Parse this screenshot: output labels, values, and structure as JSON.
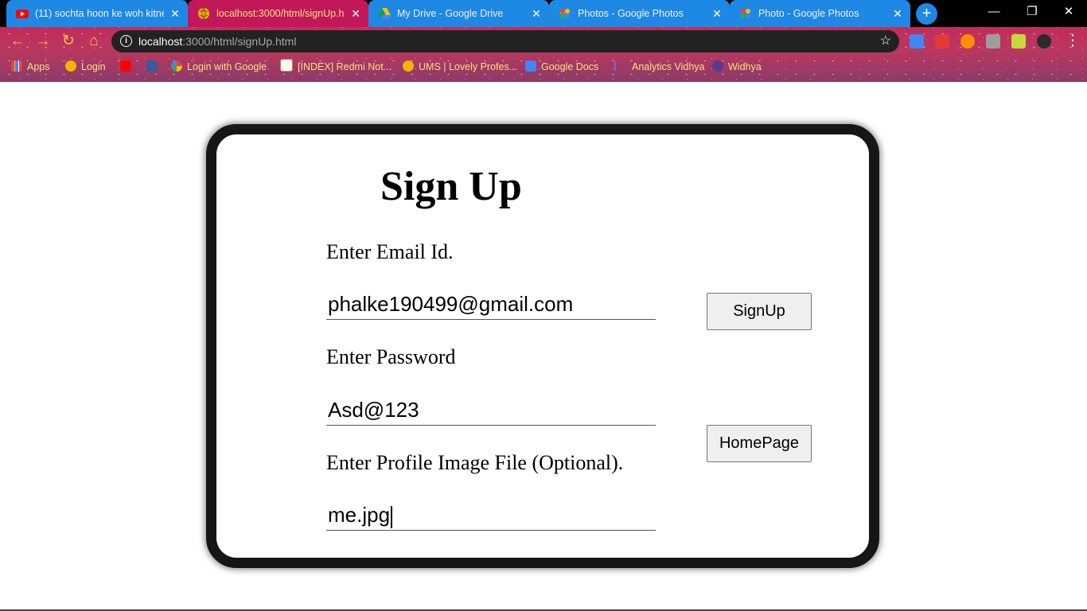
{
  "browser": {
    "tabs": [
      {
        "title": "(11) sochta hoon ke woh kitne",
        "icon": "youtube-icon"
      },
      {
        "title": "localhost:3000/html/signUp.ht",
        "icon": "globe-icon",
        "active": true
      },
      {
        "title": "My Drive - Google Drive",
        "icon": "google-drive-icon"
      },
      {
        "title": "Photos - Google Photos",
        "icon": "google-photos-icon"
      },
      {
        "title": "Photo - Google Photos",
        "icon": "google-photos-icon"
      }
    ],
    "new_tab": "+",
    "window_controls": {
      "minimize": "—",
      "restore": "❐",
      "close": "✕"
    },
    "address": {
      "host": "localhost",
      "path": ":3000/html/signUp.html"
    },
    "bookmarks": [
      {
        "label": "Apps",
        "icon": "apps-grid-icon"
      },
      {
        "label": "Login",
        "icon": "globe-icon"
      },
      {
        "label": "",
        "icon": "youtube-icon"
      },
      {
        "label": "",
        "icon": "facebook-icon"
      },
      {
        "label": "Login with Google",
        "icon": "google-icon"
      },
      {
        "label": "[INDEX] Redmi Not...",
        "icon": "xda-icon"
      },
      {
        "label": "UMS | Lovely Profes...",
        "icon": "globe-icon"
      },
      {
        "label": "Google Docs",
        "icon": "google-docs-icon"
      },
      {
        "label": "Analytics Vidhya",
        "icon": "analytics-vidhya-icon"
      },
      {
        "label": "Widhya",
        "icon": "widhya-icon"
      }
    ]
  },
  "page": {
    "title": "Sign Up",
    "email_label": "Enter Email Id.",
    "email_value": "phalke190499@gmail.com",
    "password_label": "Enter Password",
    "password_value": "Asd@123",
    "image_label": "Enter Profile Image File (Optional).",
    "image_value": "me.jpg",
    "signup_button": "SignUp",
    "homepage_button": "HomePage"
  },
  "colors": {
    "tab_inactive": "#1e88e5",
    "tab_active": "#c2185b",
    "toolbar": "#c42c5b",
    "bookmark_text": "#f7e27a",
    "card_border": "#161616"
  }
}
